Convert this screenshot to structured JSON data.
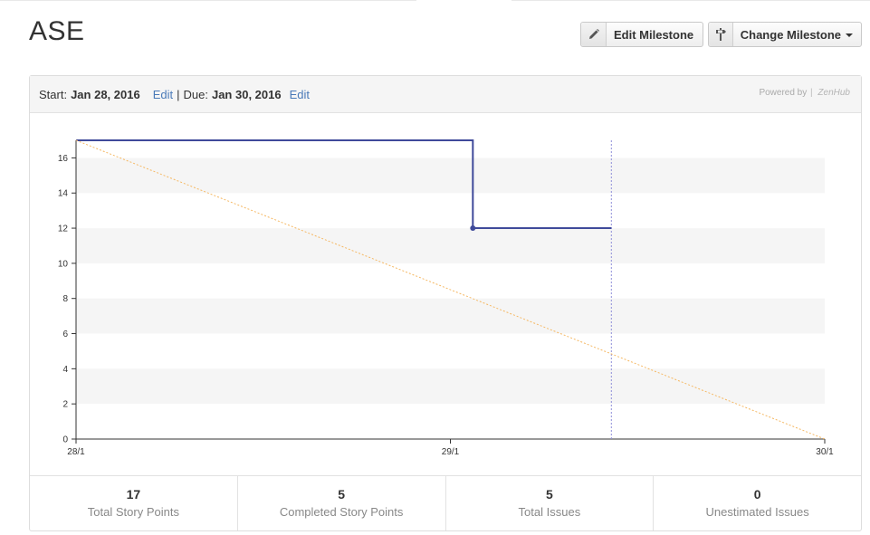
{
  "milestone": {
    "title": "ASE"
  },
  "buttons": {
    "edit_label": "Edit Milestone",
    "change_label": "Change Milestone"
  },
  "header": {
    "start_label": "Start:",
    "start_date": "Jan 28, 2016",
    "edit_start": "Edit",
    "separator": "|",
    "due_label": "Due:",
    "due_date": "Jan 30, 2016",
    "edit_due": "Edit",
    "powered_by": "Powered by",
    "brand": "ZenHub"
  },
  "chart_data": {
    "type": "line",
    "title": "",
    "xlabel": "",
    "ylabel": "",
    "x_ticks": [
      "28/1",
      "29/1",
      "30/1"
    ],
    "xlim": [
      0,
      2
    ],
    "ylim": [
      0,
      17
    ],
    "y_ticks": [
      0,
      2,
      4,
      6,
      8,
      10,
      12,
      14,
      16
    ],
    "grid": "alternating horizontal bands",
    "series": [
      {
        "kind": "remaining",
        "color": "#3f4a9a",
        "step": true,
        "points": [
          [
            0,
            17
          ],
          [
            1.06,
            17
          ],
          [
            1.06,
            12
          ],
          [
            1.43,
            12
          ]
        ],
        "markers": [
          [
            1.06,
            12
          ]
        ]
      },
      {
        "kind": "ideal",
        "color": "#f5b863",
        "dashed": true,
        "points": [
          [
            0,
            17
          ],
          [
            2,
            0
          ]
        ]
      }
    ],
    "today_x": 1.43,
    "today_color": "#8f8fd8"
  },
  "stats": [
    {
      "value": "17",
      "label": "Total Story Points"
    },
    {
      "value": "5",
      "label": "Completed Story Points"
    },
    {
      "value": "5",
      "label": "Total Issues"
    },
    {
      "value": "0",
      "label": "Unestimated Issues"
    }
  ],
  "colors": {
    "link": "#4a7ab8",
    "line": "#3f4a9a",
    "ideal": "#f5b863"
  }
}
